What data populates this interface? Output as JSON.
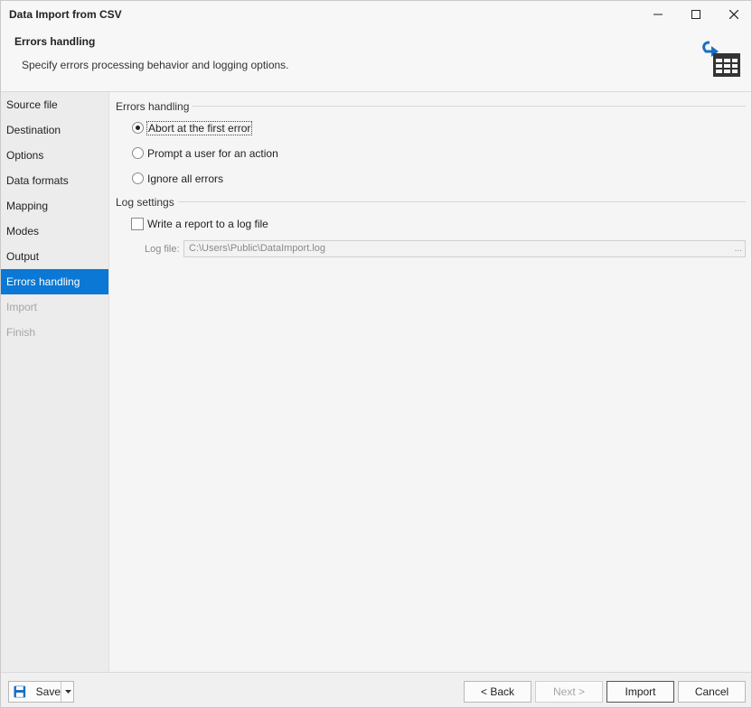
{
  "window": {
    "title": "Data Import from CSV"
  },
  "header": {
    "title": "Errors handling",
    "subtitle": "Specify errors processing behavior and logging options."
  },
  "sidebar": {
    "items": [
      {
        "label": "Source file",
        "state": "normal"
      },
      {
        "label": "Destination",
        "state": "normal"
      },
      {
        "label": "Options",
        "state": "normal"
      },
      {
        "label": "Data formats",
        "state": "normal"
      },
      {
        "label": "Mapping",
        "state": "normal"
      },
      {
        "label": "Modes",
        "state": "normal"
      },
      {
        "label": "Output",
        "state": "normal"
      },
      {
        "label": "Errors handling",
        "state": "active"
      },
      {
        "label": "Import",
        "state": "disabled"
      },
      {
        "label": "Finish",
        "state": "disabled"
      }
    ]
  },
  "errors_group": {
    "label": "Errors handling",
    "options": [
      {
        "label": "Abort at the first error",
        "checked": true
      },
      {
        "label": "Prompt a user for an action",
        "checked": false
      },
      {
        "label": "Ignore all errors",
        "checked": false
      }
    ]
  },
  "log_group": {
    "label": "Log settings",
    "write_report": {
      "label": "Write a report to a log file",
      "checked": false
    },
    "log_file_label": "Log file:",
    "log_file_value": "C:\\Users\\Public\\DataImport.log",
    "browse_label": "..."
  },
  "footer": {
    "save_label": "Save",
    "back_label": "< Back",
    "next_label": "Next >",
    "import_label": "Import",
    "cancel_label": "Cancel"
  },
  "colors": {
    "accent": "#0a78d4",
    "icon_blue": "#1a6fc0",
    "icon_dark": "#333333"
  }
}
